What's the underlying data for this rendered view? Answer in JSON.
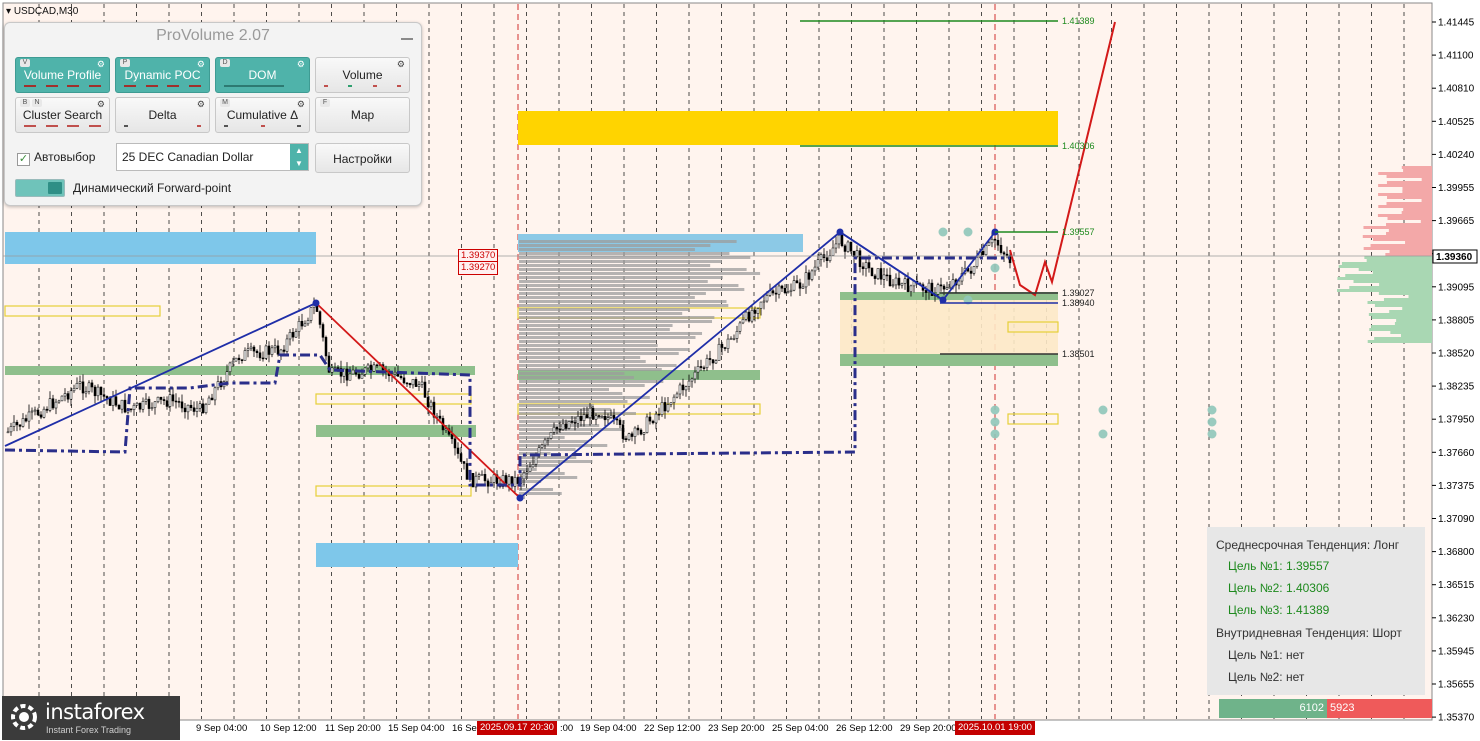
{
  "symbol": "USDCAD,M30",
  "panel": {
    "title": "ProVolume 2.07",
    "buttons": [
      {
        "label": "Volume Profile",
        "key": "V",
        "active": true
      },
      {
        "label": "Dynamic POC",
        "key": "P",
        "active": true
      },
      {
        "label": "DOM",
        "key": "D",
        "active": true
      },
      {
        "label": "Volume",
        "key": "",
        "active": false
      },
      {
        "label": "Cluster Search",
        "key": "B",
        "key2": "N",
        "active": false
      },
      {
        "label": "Delta",
        "key": "",
        "active": false
      },
      {
        "label": "Cumulative Δ",
        "key": "M",
        "active": false
      },
      {
        "label": "Map",
        "key": "F",
        "active": false
      }
    ],
    "autoselect_label": "Автовыбор",
    "instrument": "25 DEC Canadian Dollar",
    "settings_label": "Настройки",
    "forward_label": "Динамический Forward-point"
  },
  "price_axis": [
    "1.41445",
    "1.41100",
    "1.40810",
    "1.40525",
    "1.40240",
    "1.39955",
    "1.39665",
    "1.39360",
    "1.39095",
    "1.38805",
    "1.38520",
    "1.38235",
    "1.37950",
    "1.37660",
    "1.37375",
    "1.37090",
    "1.36800",
    "1.36515",
    "1.36230",
    "1.35945",
    "1.35655",
    "1.35370"
  ],
  "current_price": "1.39360",
  "time_axis": [
    "9 Sep 04:00",
    "10 Sep 12:00",
    "11 Sep 20:00",
    "15 Sep 04:00",
    "16 Sep 12:00",
    "2025.09.17 20:30",
    "19 Sep 04:00",
    "22 Sep 12:00",
    "23 Sep 20:00",
    "25 Sep 04:00",
    "26 Sep 12:00",
    "29 Sep 20:00",
    "2025.10.01 19:00"
  ],
  "time_prefix_partial": ":00",
  "levels": {
    "t3": "1.41389",
    "t2": "1.40306",
    "t1": "1.39557",
    "l1": "1.39027",
    "l2": "1.38940",
    "l3": "1.38501",
    "box1": "1.39370",
    "box2": "1.39270"
  },
  "trend": {
    "mid_title": "Среднесрочная Тенденция: Лонг",
    "mid_targets": [
      "Цель №1: 1.39557",
      "Цель №2: 1.40306",
      "Цель №3: 1.41389"
    ],
    "intra_title": "Внутридневная Тенденция: Шорт",
    "intra_targets": [
      "Цель №1: нет",
      "Цель №2: нет"
    ]
  },
  "counter": {
    "buy": "6102",
    "sell": "5923"
  },
  "logo": {
    "name": "instaforex",
    "tagline": "Instant Forex Trading"
  },
  "colors": {
    "background": "#fff4ee",
    "accent": "#4fb3aa",
    "bull": "#1e8a1e",
    "bear": "#c00000",
    "pattern_blue": "#1f2ea8"
  }
}
